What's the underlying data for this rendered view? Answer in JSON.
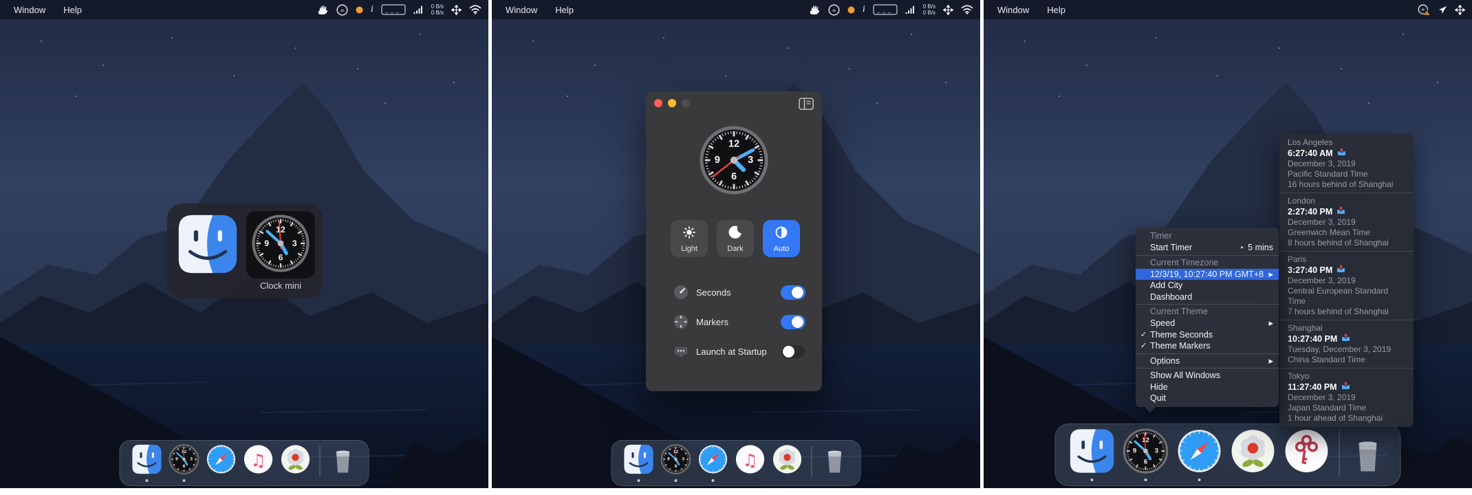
{
  "shared": {
    "menubar": {
      "menus": [
        "Window",
        "Help"
      ],
      "rates": [
        "0 B/s",
        "0 B/s"
      ]
    },
    "glyphs": {
      "checkmark": "✓",
      "submenu_arrow": "▶",
      "detail_arrow": "▸",
      "info": "i",
      "music_note": "♫"
    },
    "clock_numerals": [
      "12",
      "3",
      "6",
      "9"
    ],
    "colors": {
      "accent_blue": "#3478f6",
      "menu_highlight": "#2e66dd",
      "second_hand_red": "#ff453a",
      "clock_hand_blue": "#4ab0f8",
      "traffic_red": "#ff5f57",
      "traffic_yellow": "#febc2e"
    }
  },
  "clocks": {
    "window": {
      "hour": 135,
      "minute": 62,
      "second": 232
    },
    "icon": {
      "hour": 150,
      "minute": 312,
      "second": 356
    }
  },
  "panels": [
    {
      "name": "desktop-with-app-switcher",
      "status_icons": [
        "hand-icon",
        "creative-cloud-icon",
        "status-dot-icon",
        "info-icon",
        "battery-box-icon",
        "signal-bars-icon",
        "rates",
        "move-arrows-icon",
        "wifi-icon"
      ],
      "app_switcher": {
        "apps": [
          "Finder",
          "Clock mini"
        ],
        "selected": "Clock mini",
        "label": "Clock mini"
      },
      "dock": {
        "size": "small",
        "items": [
          {
            "icon": "finder",
            "running": true
          },
          {
            "icon": "clock",
            "running": true
          },
          {
            "icon": "safari",
            "running": false
          },
          {
            "icon": "music",
            "running": false
          },
          {
            "icon": "flower",
            "running": false
          }
        ],
        "trash": "trash"
      }
    },
    {
      "name": "desktop-with-preferences-window",
      "status_icons": [
        "hand-icon",
        "creative-cloud-icon",
        "status-dot-icon",
        "info-icon",
        "battery-box-icon",
        "signal-bars-icon",
        "rates",
        "move-arrows-icon",
        "wifi-icon"
      ],
      "window": {
        "traffic_lights": [
          "close",
          "minimize",
          "zoom"
        ],
        "theme_buttons": [
          {
            "label": "Light",
            "icon": "sun-icon",
            "selected": false
          },
          {
            "label": "Dark",
            "icon": "moon-icon",
            "selected": false
          },
          {
            "label": "Auto",
            "icon": "auto-contrast-icon",
            "selected": true
          }
        ],
        "toggles": [
          {
            "label": "Seconds",
            "icon": "second-hand-icon",
            "on": true
          },
          {
            "label": "Markers",
            "icon": "markers-icon",
            "on": true
          },
          {
            "label": "Launch at Startup",
            "icon": "startup-display-icon",
            "on": false
          }
        ]
      },
      "dock": {
        "size": "small",
        "items": [
          {
            "icon": "finder",
            "running": true
          },
          {
            "icon": "clock",
            "running": true
          },
          {
            "icon": "safari",
            "running": true
          },
          {
            "icon": "music",
            "running": false
          },
          {
            "icon": "flower",
            "running": false
          }
        ],
        "trash": "trash"
      }
    },
    {
      "name": "desktop-with-dock-menu",
      "status_icons": [
        "creative-cloud-warning-icon",
        "location-arrow-icon",
        "move-arrows-icon"
      ],
      "context_menu": {
        "sections": [
          {
            "items": [
              {
                "type": "header",
                "label": "Timer"
              },
              {
                "label": "Start Timer",
                "detail": "5 mins",
                "detail_arrow": true
              }
            ]
          },
          {
            "items": [
              {
                "type": "header",
                "label": "Current Timezone"
              },
              {
                "label": "12/3/19, 10:27:40 PM GMT+8",
                "highlighted": true,
                "submenu": true
              },
              {
                "label": "Add City"
              },
              {
                "label": "Dashboard"
              }
            ]
          },
          {
            "items": [
              {
                "type": "header",
                "label": "Current Theme"
              },
              {
                "label": "Speed",
                "submenu": true
              },
              {
                "label": "Theme Seconds",
                "checked": true
              },
              {
                "label": "Theme Markers",
                "checked": true
              }
            ]
          },
          {
            "items": [
              {
                "label": "Options",
                "submenu": true
              }
            ]
          },
          {
            "items": [
              {
                "label": "Show All Windows"
              },
              {
                "label": "Hide"
              },
              {
                "label": "Quit"
              }
            ]
          }
        ]
      },
      "world_clocks": [
        {
          "city": "Los Angeles",
          "time": "6:27:40 AM",
          "date": "December 3, 2019",
          "timezone": "Pacific Standard Time",
          "offset": "16 hours behind of Shanghai"
        },
        {
          "city": "London",
          "time": "2:27:40 PM",
          "date": "December 3, 2019",
          "timezone": "Greenwich Mean Time",
          "offset": "8 hours behind of Shanghai"
        },
        {
          "city": "Paris",
          "time": "3:27:40 PM",
          "date": "December 3, 2019",
          "timezone": "Central European Standard Time",
          "offset": "7 hours behind of Shanghai"
        },
        {
          "city": "Shanghai",
          "time": "10:27:40 PM",
          "date": "Tuesday, December 3, 2019",
          "timezone": "China Standard Time",
          "offset": ""
        },
        {
          "city": "Tokyo",
          "time": "11:27:40 PM",
          "date": "December 3, 2019",
          "timezone": "Japan Standard Time",
          "offset": "1 hour ahead of Shanghai"
        }
      ],
      "dock": {
        "size": "large",
        "items": [
          {
            "icon": "finder",
            "running": true
          },
          {
            "icon": "clock",
            "running": true
          },
          {
            "icon": "safari",
            "running": true
          },
          {
            "icon": "flower",
            "running": false
          },
          {
            "icon": "keys",
            "running": false
          }
        ],
        "trash": "trash"
      }
    }
  ]
}
